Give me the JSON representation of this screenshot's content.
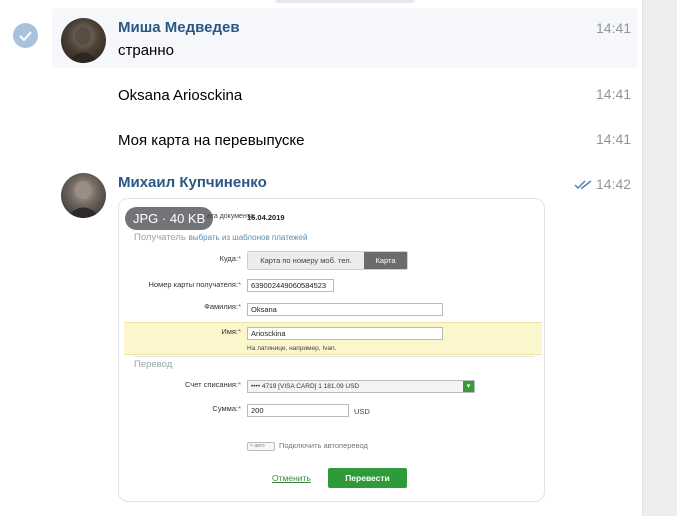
{
  "messages": [
    {
      "author": "Миша Медведев",
      "text": "странно",
      "time": "14:41"
    },
    {
      "text": "Oksana Ariosckina",
      "time": "14:41"
    },
    {
      "text": "Моя карта на перевыпуске",
      "time": "14:41"
    },
    {
      "author": "Михаил Купчиненко",
      "time": "14:42"
    }
  ],
  "attachment": {
    "badge": "JPG · 40 KB",
    "form": {
      "date_label": "ата документа:",
      "date_value": "16.04.2019",
      "recipient_section": "Получатель",
      "recipient_link": "выбрать из шаблонов платежей",
      "where_label": "Куда:",
      "seg_phone": "Карта по номеру моб. тел.",
      "seg_card": "Карта",
      "card_number_label": "Номер карты получателя:",
      "card_number_value": "639002449060584523",
      "surname_label": "Фамилия:",
      "surname_value": "Oksana",
      "name_label": "Имя:",
      "name_value": "Ariosckina",
      "name_hint": "На латинице, например, Ivan.",
      "transfer_section": "Перевод",
      "account_label": "Счет списания:",
      "account_value": "•••• 4719 [VISA CARD] 1 181.09   USD",
      "amount_label": "Сумма:",
      "amount_value": "200",
      "currency": "USD",
      "auto_toggle": "авто",
      "auto_label": "Подключить автоперевод",
      "cancel": "Отменить",
      "submit": "Перевести"
    }
  },
  "colors": {
    "author": "#2a5885",
    "time": "#939699",
    "submit": "#2f9a3a",
    "highlight": "#fbf6cc"
  }
}
